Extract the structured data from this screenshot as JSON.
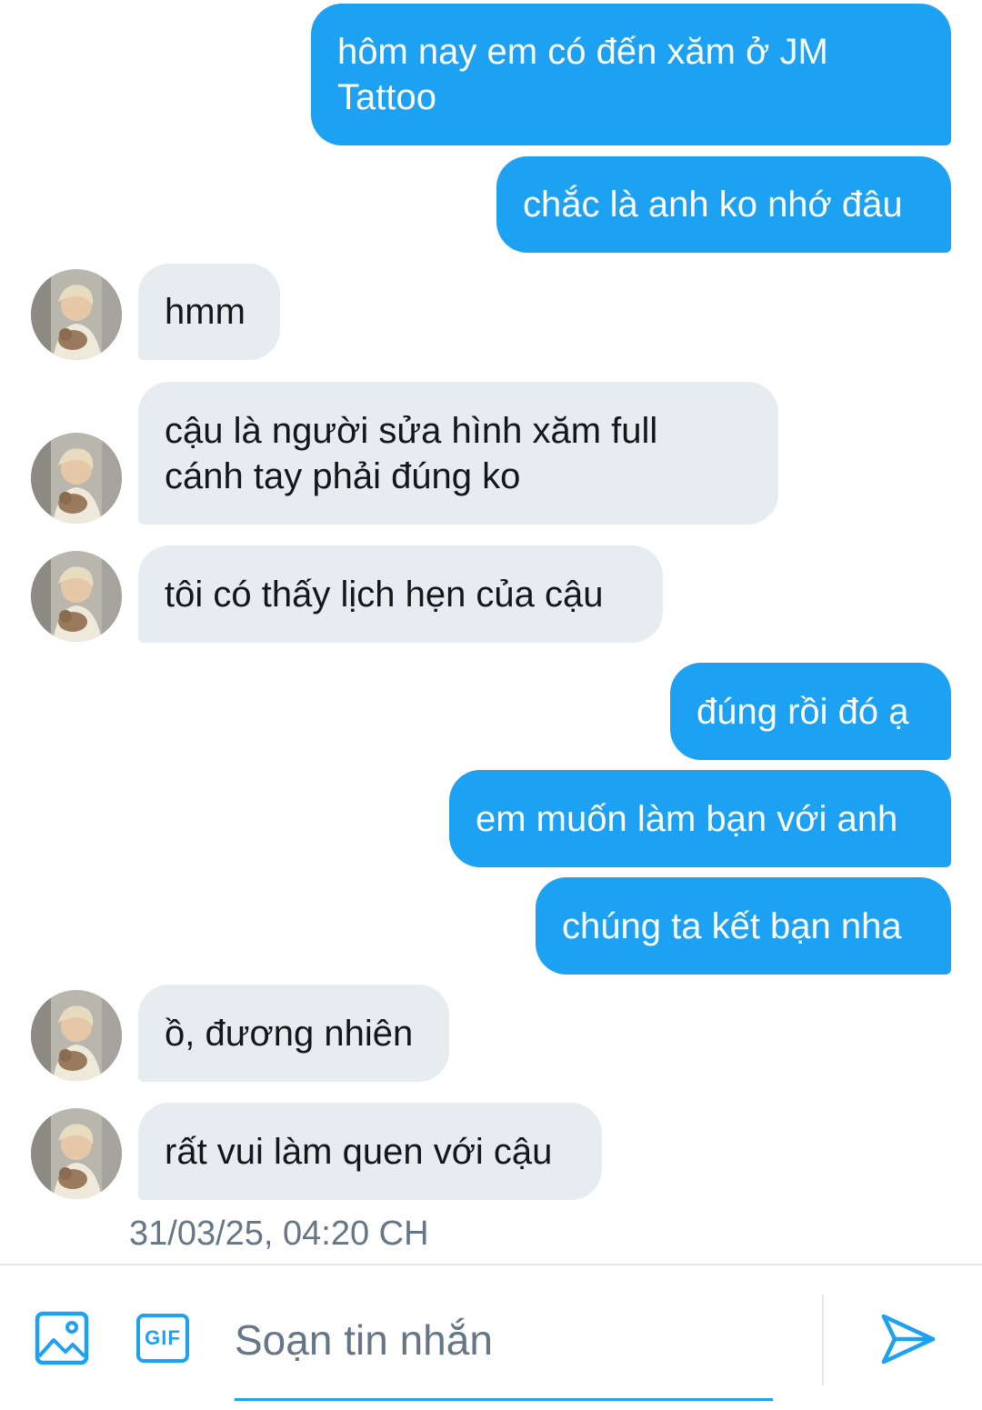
{
  "conversation": {
    "messages": [
      {
        "direction": "sent",
        "text": "hôm nay em có đến xăm ở JM\nTattoo"
      },
      {
        "direction": "sent",
        "text": "chắc là anh ko nhớ đâu"
      },
      {
        "direction": "received",
        "text": "hmm"
      },
      {
        "direction": "received",
        "text": "cậu là người sửa hình xăm full\ncánh tay phải đúng ko"
      },
      {
        "direction": "received",
        "text": "tôi có thấy lịch hẹn của cậu"
      },
      {
        "direction": "sent",
        "text": "đúng rồi đó ạ"
      },
      {
        "direction": "sent",
        "text": "em muốn làm bạn với anh"
      },
      {
        "direction": "sent",
        "text": "chúng ta kết bạn nha"
      },
      {
        "direction": "received",
        "text": "ồ, đương nhiên"
      },
      {
        "direction": "received",
        "text": "rất vui làm quen với cậu"
      }
    ],
    "timestamp": "31/03/25, 04:20 CH"
  },
  "composer": {
    "image_icon": "image-icon",
    "gif_label": "GIF",
    "input_value": "",
    "input_placeholder": "Soạn tin nhắn",
    "send_icon": "send-icon"
  },
  "colors": {
    "sent_bubble": "#1da1f2",
    "received_bubble": "#e6ecf0",
    "accent": "#1da1f2",
    "timestamp": "#657786"
  }
}
